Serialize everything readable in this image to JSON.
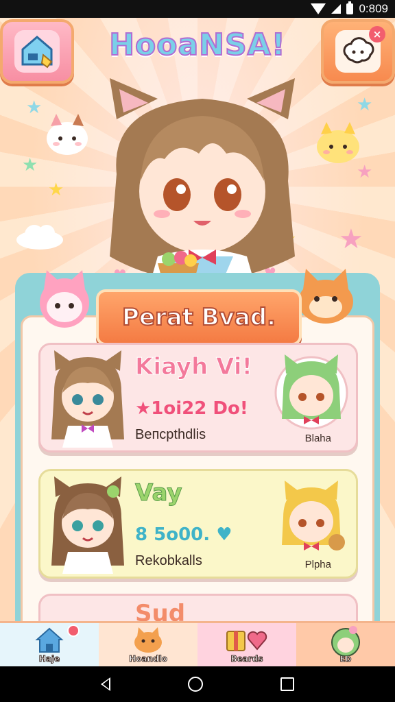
{
  "status_bar": {
    "time": "0:809"
  },
  "header": {
    "title": "HooaNSA!",
    "left_button_icon": "diamond-house-icon",
    "right_button_icon": "settings-cloud-icon",
    "right_badge": "×"
  },
  "panel": {
    "banner_title": "Perat Bvad.",
    "cards": [
      {
        "title": "Kiayh Vi!",
        "score": "★1oi22 Do!",
        "subtitle": "Beпcpthdlis",
        "right_label": "Blaha"
      },
      {
        "title": "Vay",
        "score": "8 5o00. ♥",
        "subtitle": "Rekobkalls",
        "right_label": "Plpha"
      },
      {
        "title": "Sud"
      }
    ]
  },
  "bottom_nav": [
    {
      "label": "Haje",
      "icon": "house-icon",
      "has_badge": true
    },
    {
      "label": "Hoandlo",
      "icon": "cat-face-icon"
    },
    {
      "label": "Beards",
      "icon": "gift-heart-icon"
    },
    {
      "label": "Eb",
      "icon": "avatar-icon"
    }
  ],
  "colors": {
    "banner": "#f47b43",
    "panel_frame": "#8fd3d8",
    "card_pink": "#fde6e6",
    "card_yellow": "#fbf7c9"
  }
}
